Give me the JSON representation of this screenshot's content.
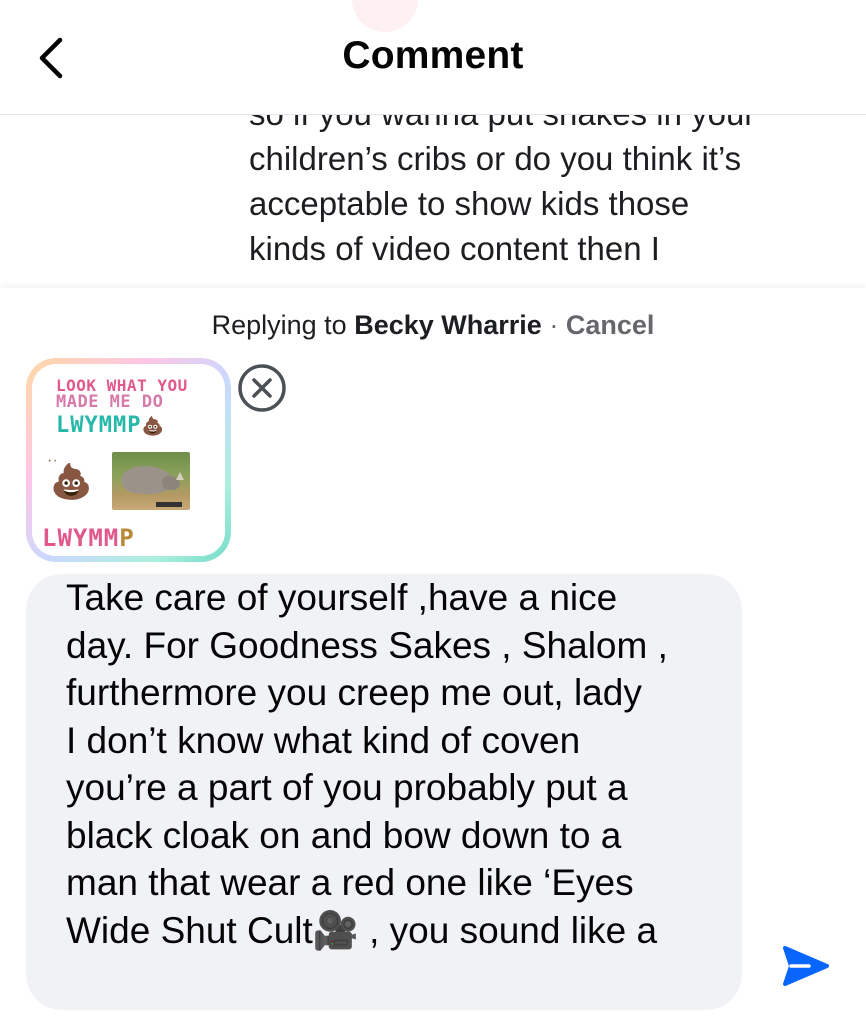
{
  "header": {
    "title": "Comment",
    "back_icon": "chevron-left-icon"
  },
  "parent_comment": {
    "lines": [
      "so if you wanna put snakes in your",
      "children’s cribs or do you think it’s",
      "acceptable to show kids those",
      "kinds of video content then I"
    ]
  },
  "reply": {
    "replying_to_label": "Replying to",
    "name": "Becky Wharrie",
    "separator": "·",
    "cancel_label": "Cancel"
  },
  "attachment": {
    "line1": "LOOK WHAT YOU",
    "line2": "MADE ME DO",
    "line3": "LWYMMP",
    "line3_emoji": "💩",
    "left_emoji": "💩",
    "line4_a": "LWYMM",
    "line4_b": "P",
    "remove_icon": "close-circle-icon"
  },
  "composer": {
    "lines": [
      "Take care of yourself ,have a nice",
      "day. For Goodness Sakes , Shalom ,",
      "furthermore you creep me out, lady",
      "I don’t know what kind of coven",
      "you’re a part of you probably put a",
      "black cloak on and bow down to a",
      "man that wear a red one like ‘Eyes",
      "Wide Shut Cult🎥 , you sound like a"
    ]
  },
  "send": {
    "icon": "send-icon"
  },
  "colors": {
    "accent": "#0866ff",
    "muted": "#65676b",
    "composer_bg": "#f0f2f5"
  }
}
